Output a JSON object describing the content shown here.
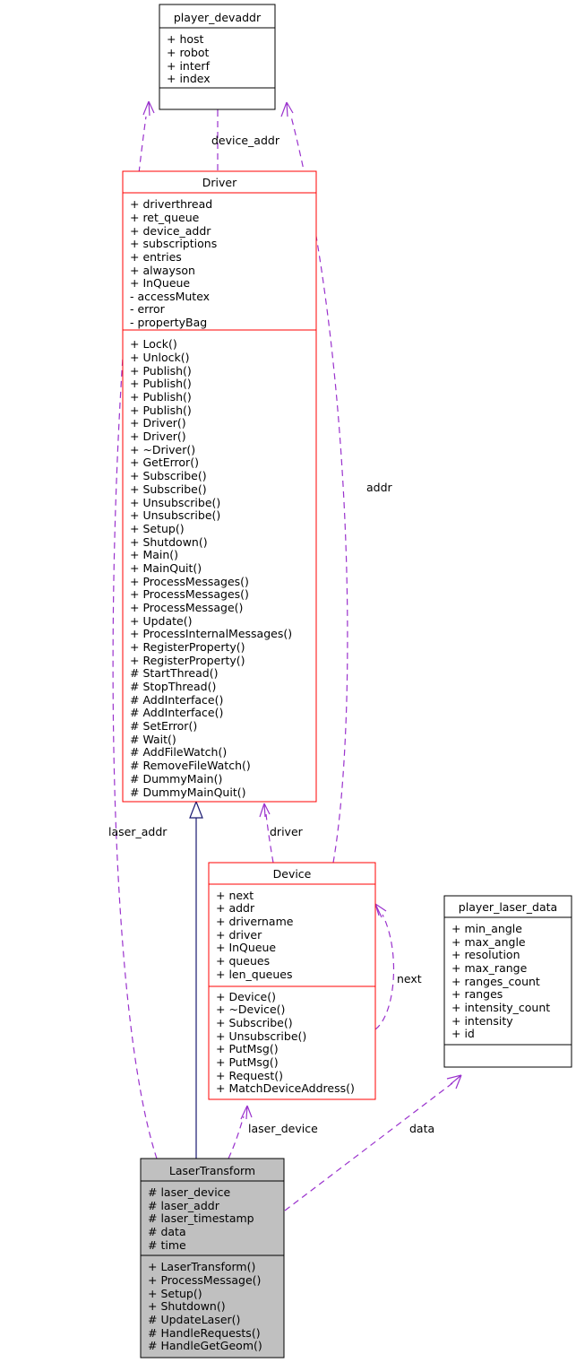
{
  "diagram": {
    "type": "uml-class-diagram",
    "background": "#ffffff",
    "colors": {
      "association": "#9a32cd",
      "inheritance": "#191970",
      "red_border": "#ff0000",
      "black_border": "#000000",
      "grey_fill": "#c0c0c0"
    }
  },
  "classes": {
    "player_devaddr": {
      "name": "player_devaddr",
      "attributes": [
        "+ host",
        "+ robot",
        "+ interf",
        "+ index"
      ],
      "methods": []
    },
    "driver": {
      "name": "Driver",
      "attributes": [
        "+ driverthread",
        "+ ret_queue",
        "+ device_addr",
        "+ subscriptions",
        "+ entries",
        "+ alwayson",
        "+ InQueue",
        "- accessMutex",
        "- error",
        "- propertyBag"
      ],
      "methods": [
        "+ Lock()",
        "+ Unlock()",
        "+ Publish()",
        "+ Publish()",
        "+ Publish()",
        "+ Publish()",
        "+ Driver()",
        "+ Driver()",
        "+ ~Driver()",
        "+ GetError()",
        "+ Subscribe()",
        "+ Subscribe()",
        "+ Unsubscribe()",
        "+ Unsubscribe()",
        "+ Setup()",
        "+ Shutdown()",
        "+ Main()",
        "+ MainQuit()",
        "+ ProcessMessages()",
        "+ ProcessMessages()",
        "+ ProcessMessage()",
        "+ Update()",
        "+ ProcessInternalMessages()",
        "+ RegisterProperty()",
        "+ RegisterProperty()",
        "# StartThread()",
        "# StopThread()",
        "# AddInterface()",
        "# AddInterface()",
        "# SetError()",
        "# Wait()",
        "# AddFileWatch()",
        "# RemoveFileWatch()",
        "# DummyMain()",
        "# DummyMainQuit()"
      ]
    },
    "device": {
      "name": "Device",
      "attributes": [
        "+ next",
        "+ addr",
        "+ drivername",
        "+ driver",
        "+ InQueue",
        "+ queues",
        "+ len_queues"
      ],
      "methods": [
        "+ Device()",
        "+ ~Device()",
        "+ Subscribe()",
        "+ Unsubscribe()",
        "+ PutMsg()",
        "+ PutMsg()",
        "+ Request()",
        "+ MatchDeviceAddress()"
      ]
    },
    "player_laser_data": {
      "name": "player_laser_data",
      "attributes": [
        "+ min_angle",
        "+ max_angle",
        "+ resolution",
        "+ max_range",
        "+ ranges_count",
        "+ ranges",
        "+ intensity_count",
        "+ intensity",
        "+ id"
      ],
      "methods": []
    },
    "laser_transform": {
      "name": "LaserTransform",
      "attributes": [
        "# laser_device",
        "# laser_addr",
        "# laser_timestamp",
        "# data",
        "# time"
      ],
      "methods": [
        "+ LaserTransform()",
        "+ ProcessMessage()",
        "+ Setup()",
        "+ Shutdown()",
        "# UpdateLaser()",
        "# HandleRequests()",
        "# HandleGetGeom()"
      ]
    }
  },
  "edges": [
    {
      "id": "device_addr",
      "label": "device_addr",
      "from": "driver",
      "to": "player_devaddr",
      "kind": "association"
    },
    {
      "id": "addr",
      "label": "addr",
      "from": "device",
      "to": "player_devaddr",
      "kind": "association"
    },
    {
      "id": "laser_addr",
      "label": "laser_addr",
      "from": "laser_transform",
      "to": "player_devaddr",
      "kind": "association"
    },
    {
      "id": "driver",
      "label": "driver",
      "from": "device",
      "to": "driver",
      "kind": "association"
    },
    {
      "id": "next",
      "label": "next",
      "from": "device",
      "to": "device",
      "kind": "association"
    },
    {
      "id": "laser_device",
      "label": "laser_device",
      "from": "laser_transform",
      "to": "device",
      "kind": "association"
    },
    {
      "id": "data",
      "label": "data",
      "from": "laser_transform",
      "to": "player_laser_data",
      "kind": "association"
    },
    {
      "id": "inheritance",
      "label": "",
      "from": "laser_transform",
      "to": "driver",
      "kind": "inheritance"
    }
  ]
}
